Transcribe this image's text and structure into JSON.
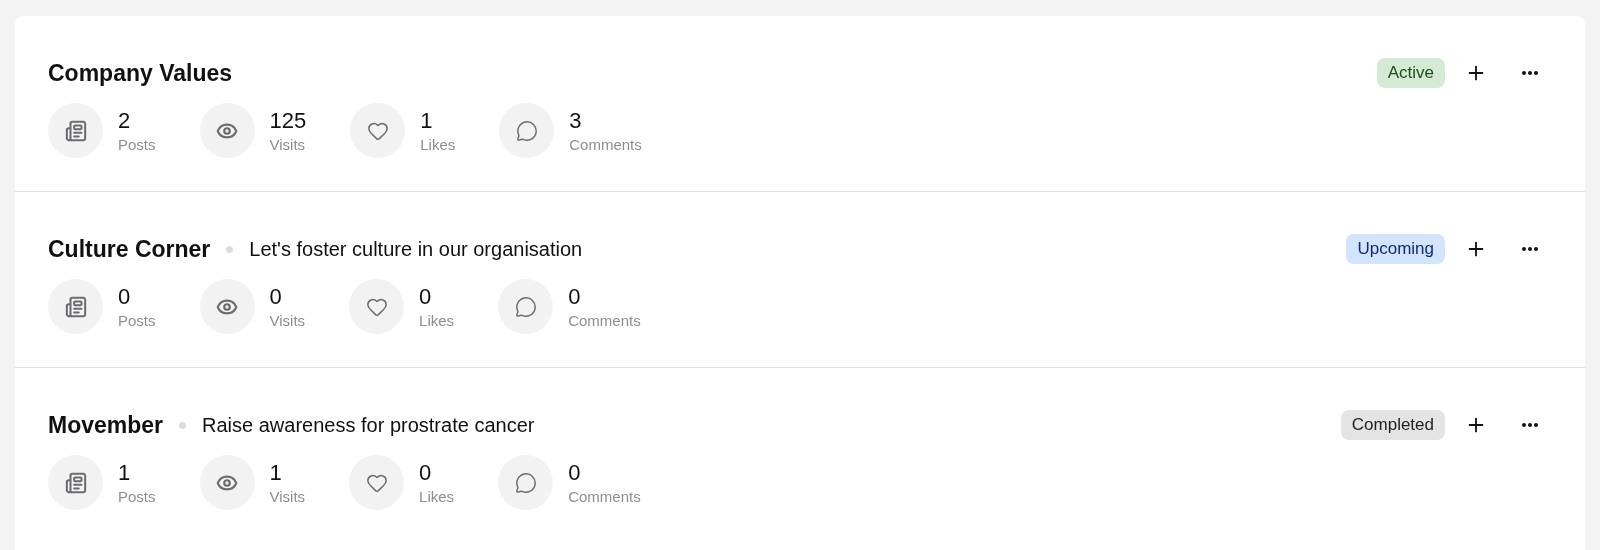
{
  "campaigns": [
    {
      "title": "Company Values",
      "status": {
        "label": "Active",
        "kind": "active"
      },
      "stats": [
        {
          "kind": "posts",
          "value": "2",
          "label": "Posts"
        },
        {
          "kind": "visits",
          "value": "125",
          "label": "Visits"
        },
        {
          "kind": "likes",
          "value": "1",
          "label": "Likes"
        },
        {
          "kind": "comments",
          "value": "3",
          "label": "Comments"
        }
      ]
    },
    {
      "title": "Culture Corner",
      "description": "Let's foster culture in our organisation",
      "status": {
        "label": "Upcoming",
        "kind": "upcoming"
      },
      "stats": [
        {
          "kind": "posts",
          "value": "0",
          "label": "Posts"
        },
        {
          "kind": "visits",
          "value": "0",
          "label": "Visits"
        },
        {
          "kind": "likes",
          "value": "0",
          "label": "Likes"
        },
        {
          "kind": "comments",
          "value": "0",
          "label": "Comments"
        }
      ]
    },
    {
      "title": "Movember",
      "description": "Raise awareness for prostrate cancer",
      "status": {
        "label": "Completed",
        "kind": "completed"
      },
      "stats": [
        {
          "kind": "posts",
          "value": "1",
          "label": "Posts"
        },
        {
          "kind": "visits",
          "value": "1",
          "label": "Visits"
        },
        {
          "kind": "likes",
          "value": "0",
          "label": "Likes"
        },
        {
          "kind": "comments",
          "value": "0",
          "label": "Comments"
        }
      ]
    }
  ]
}
